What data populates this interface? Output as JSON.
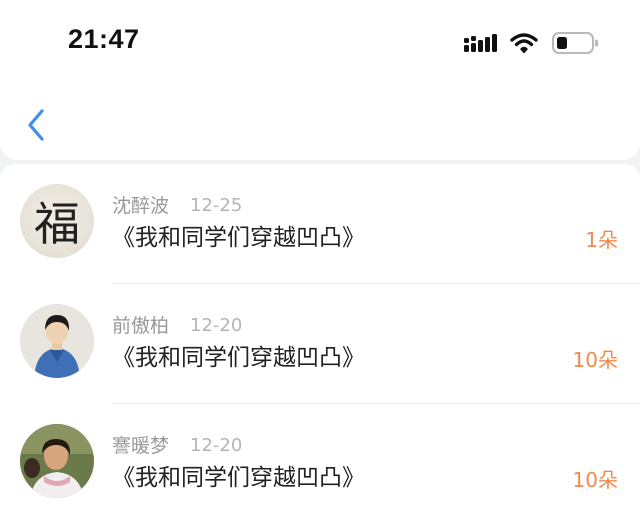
{
  "status_bar": {
    "time": "21:47",
    "icons": [
      "cellular-signal-icon",
      "wifi-icon",
      "battery-icon"
    ]
  },
  "nav": {
    "back_icon": "chevron-left-icon"
  },
  "colors": {
    "accent_blue": "#3d8fe8",
    "count_orange": "#f08a4b",
    "meta_gray": "#999999"
  },
  "list": [
    {
      "name": "沈醉波",
      "date": "12-25",
      "title": "《我和同学们穿越凹凸》",
      "count": "1朵",
      "avatar_glyph": "福"
    },
    {
      "name": "前傲柏",
      "date": "12-20",
      "title": "《我和同学们穿越凹凸》",
      "count": "10朵"
    },
    {
      "name": "謇暖梦",
      "date": "12-20",
      "title": "《我和同学们穿越凹凸》",
      "count": "10朵"
    }
  ]
}
